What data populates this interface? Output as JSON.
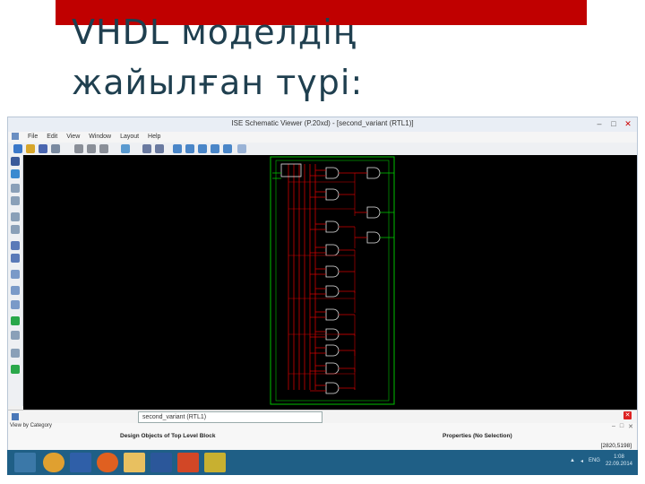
{
  "slide": {
    "title_line1": "VHDL моделдің",
    "title_line2": "жайылған түрі:",
    "accent_color": "#c00000",
    "title_color": "#1f3f4f"
  },
  "window": {
    "title": "ISE Schematic Viewer (P.20xd) - [second_variant (RTL1)]",
    "buttons": [
      "minimize-icon",
      "maximize-icon",
      "close-icon"
    ]
  },
  "menubar": {
    "items": [
      "File",
      "Edit",
      "View",
      "Window",
      "Layout",
      "Help"
    ]
  },
  "tabs": {
    "active": "second_variant (RTL1)"
  },
  "bottom": {
    "view_by": "View by Category",
    "left_panel_title": "Design Objects of Top Level Block",
    "right_panel_title": "Properties (No Selection)",
    "coords": "[2820,5198]"
  },
  "taskbar": {
    "icons": [
      "start-icon",
      "explorer-icon",
      "firefox-icon",
      "files-icon",
      "word-icon",
      "powerpoint-icon",
      "app-icon"
    ],
    "tray_lang": "ENG",
    "clock_time": "1:08",
    "clock_date": "22.09.2014"
  },
  "colors": {
    "canvas": "#000000",
    "wire_red": "#d00000",
    "outline_green": "#00c000",
    "gate_white": "#e6e6e6"
  }
}
